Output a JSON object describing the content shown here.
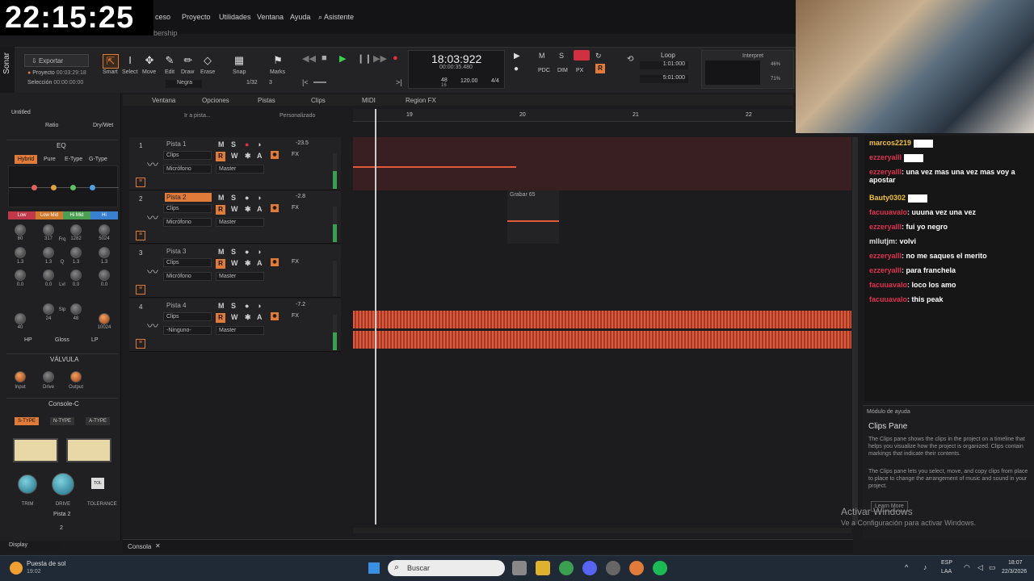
{
  "clock": "22:15:25",
  "menu": [
    "ceso",
    "Proyecto",
    "Utilidades",
    "Ventana",
    "Ayuda",
    "Asistente"
  ],
  "subtitle": "bership",
  "app_label": "Sonar",
  "toolbar": {
    "export": "Exportar",
    "proyecto": "Proyecto",
    "proyecto_time": "00:03:29:18",
    "seleccion": "Selección",
    "seleccion_time": "00:00:00:00",
    "tools": [
      "Smart",
      "Select",
      "Move",
      "Edit",
      "Draw",
      "Erase"
    ],
    "snap": "Snap",
    "snap_value": "1/32",
    "snap_num": "3",
    "marks": "Marks",
    "negra": "Negra",
    "time_main": "18:03:922",
    "time_sub": "00:00:35.480",
    "tempo": "120.00",
    "meter": "4/4",
    "beat_a": "48",
    "beat_b": "16",
    "loop": "Loop",
    "loop_start": "1:01:000",
    "loop_end": "5:01:000",
    "interpret": "Interpret",
    "pct1": "46%",
    "pct2": "71%"
  },
  "left_rack": {
    "project": "Untitled",
    "ratio": "Ratio",
    "drywet": "Dry/Wet",
    "eq": "EQ",
    "eq_modes": [
      "Hybrid",
      "Pure",
      "E-Type",
      "G-Type"
    ],
    "bands": [
      "Low",
      "Low Mid",
      "Hi Mid",
      "Hi"
    ],
    "row1": [
      "80",
      "317",
      "1282",
      "5024"
    ],
    "frq": "Frq",
    "row2": [
      "1.3",
      "1.3",
      "1.3",
      "1.3"
    ],
    "q": "Q",
    "row3": [
      "0.0",
      "0.0",
      "0.0",
      "0.0"
    ],
    "lvl": "Lvl",
    "slp": "Slp",
    "row4": [
      "40",
      "24",
      "48",
      "10024"
    ],
    "filters": [
      "HP",
      "Gloss",
      "LP"
    ],
    "valvula": "VÁLVULA",
    "valv_knobs": [
      "Input",
      "Drive",
      "Output"
    ],
    "console": "Console-C",
    "types": [
      "S-TYPE",
      "N-TYPE",
      "A-TYPE"
    ],
    "con_knobs": [
      "TRIM",
      "DRIVE",
      "TOLERANCE"
    ],
    "tol": "TOL",
    "pista": "Pista 2",
    "pista_num": "2",
    "display": "Display"
  },
  "track_menu": [
    "Ventana",
    "Opciones",
    "Pistas",
    "Clips",
    "MIDI",
    "Region FX"
  ],
  "goto": "Ir a pista...",
  "custom": "Personalizado",
  "ruler": [
    "19",
    "20",
    "21",
    "22"
  ],
  "tracks": [
    {
      "num": "1",
      "name": "Pista 1",
      "vol": "-23.5",
      "clips": "Clips",
      "input": "Micrófono",
      "out": "Master",
      "fx": "FX"
    },
    {
      "num": "2",
      "name": "Pista 2",
      "vol": "-2.8",
      "clips": "Clips",
      "input": "Micrófono",
      "out": "Master",
      "fx": "FX"
    },
    {
      "num": "3",
      "name": "Pista 3",
      "vol": "",
      "clips": "Clips",
      "input": "Micrófono",
      "out": "Master",
      "fx": "FX"
    },
    {
      "num": "4",
      "name": "Pista 4",
      "vol": "-7.2",
      "clips": "Clips",
      "input": "-Ninguno-",
      "out": "Master",
      "fx": "FX"
    }
  ],
  "clip_label": "Grabar 65",
  "console_tab": "Consola",
  "chat": [
    {
      "user": "marcos2219",
      "msg": "",
      "emote": true,
      "color": "u2"
    },
    {
      "user": "ezzeryalll",
      "msg": "",
      "emote": true,
      "color": "u"
    },
    {
      "user": "ezzeryalll",
      "msg": ": una vez mas una vez mas voy a apostar",
      "emote": false,
      "color": "u"
    },
    {
      "user": "Bauty0302",
      "msg": "",
      "emote": true,
      "color": "u2"
    },
    {
      "user": "facuuavalo",
      "msg": ": uuuna vez una vez",
      "emote": false,
      "color": "u"
    },
    {
      "user": "ezzeryalll",
      "msg": ": fui yo negro",
      "emote": false,
      "color": "u"
    },
    {
      "user": "mllutjm",
      "msg": ": volvi",
      "emote": false,
      "color": "u3"
    },
    {
      "user": "ezzeryalll",
      "msg": ": no me saques el merito",
      "emote": false,
      "color": "u"
    },
    {
      "user": "ezzeryalll",
      "msg": ": para franchela",
      "emote": false,
      "color": "u"
    },
    {
      "user": "facuuavalo",
      "msg": ": loco los amo",
      "emote": false,
      "color": "u"
    },
    {
      "user": "facuuavalo",
      "msg": ": this peak",
      "emote": false,
      "color": "u"
    }
  ],
  "help": {
    "header": "Módulo de ayuda",
    "title": "Clips Pane",
    "p1": "The Clips pane shows the clips in the project on a timeline that helps you visualize how the project is organized. Clips contain markings that indicate their contents.",
    "p2": "The Clips pane lets you select, move, and copy clips from place to place to change the arrangement of music and sound in your project.",
    "learn": "Learn More"
  },
  "watermark": {
    "line1": "Activar Windows",
    "line2": "Ve a Configuración para activar Windows."
  },
  "taskbar": {
    "weather": "Puesta de sol",
    "weather_time": "19:02",
    "search": "Buscar",
    "lang1": "ESP",
    "lang2": "LAA",
    "time": "18:07",
    "date": "22/3/2026"
  }
}
